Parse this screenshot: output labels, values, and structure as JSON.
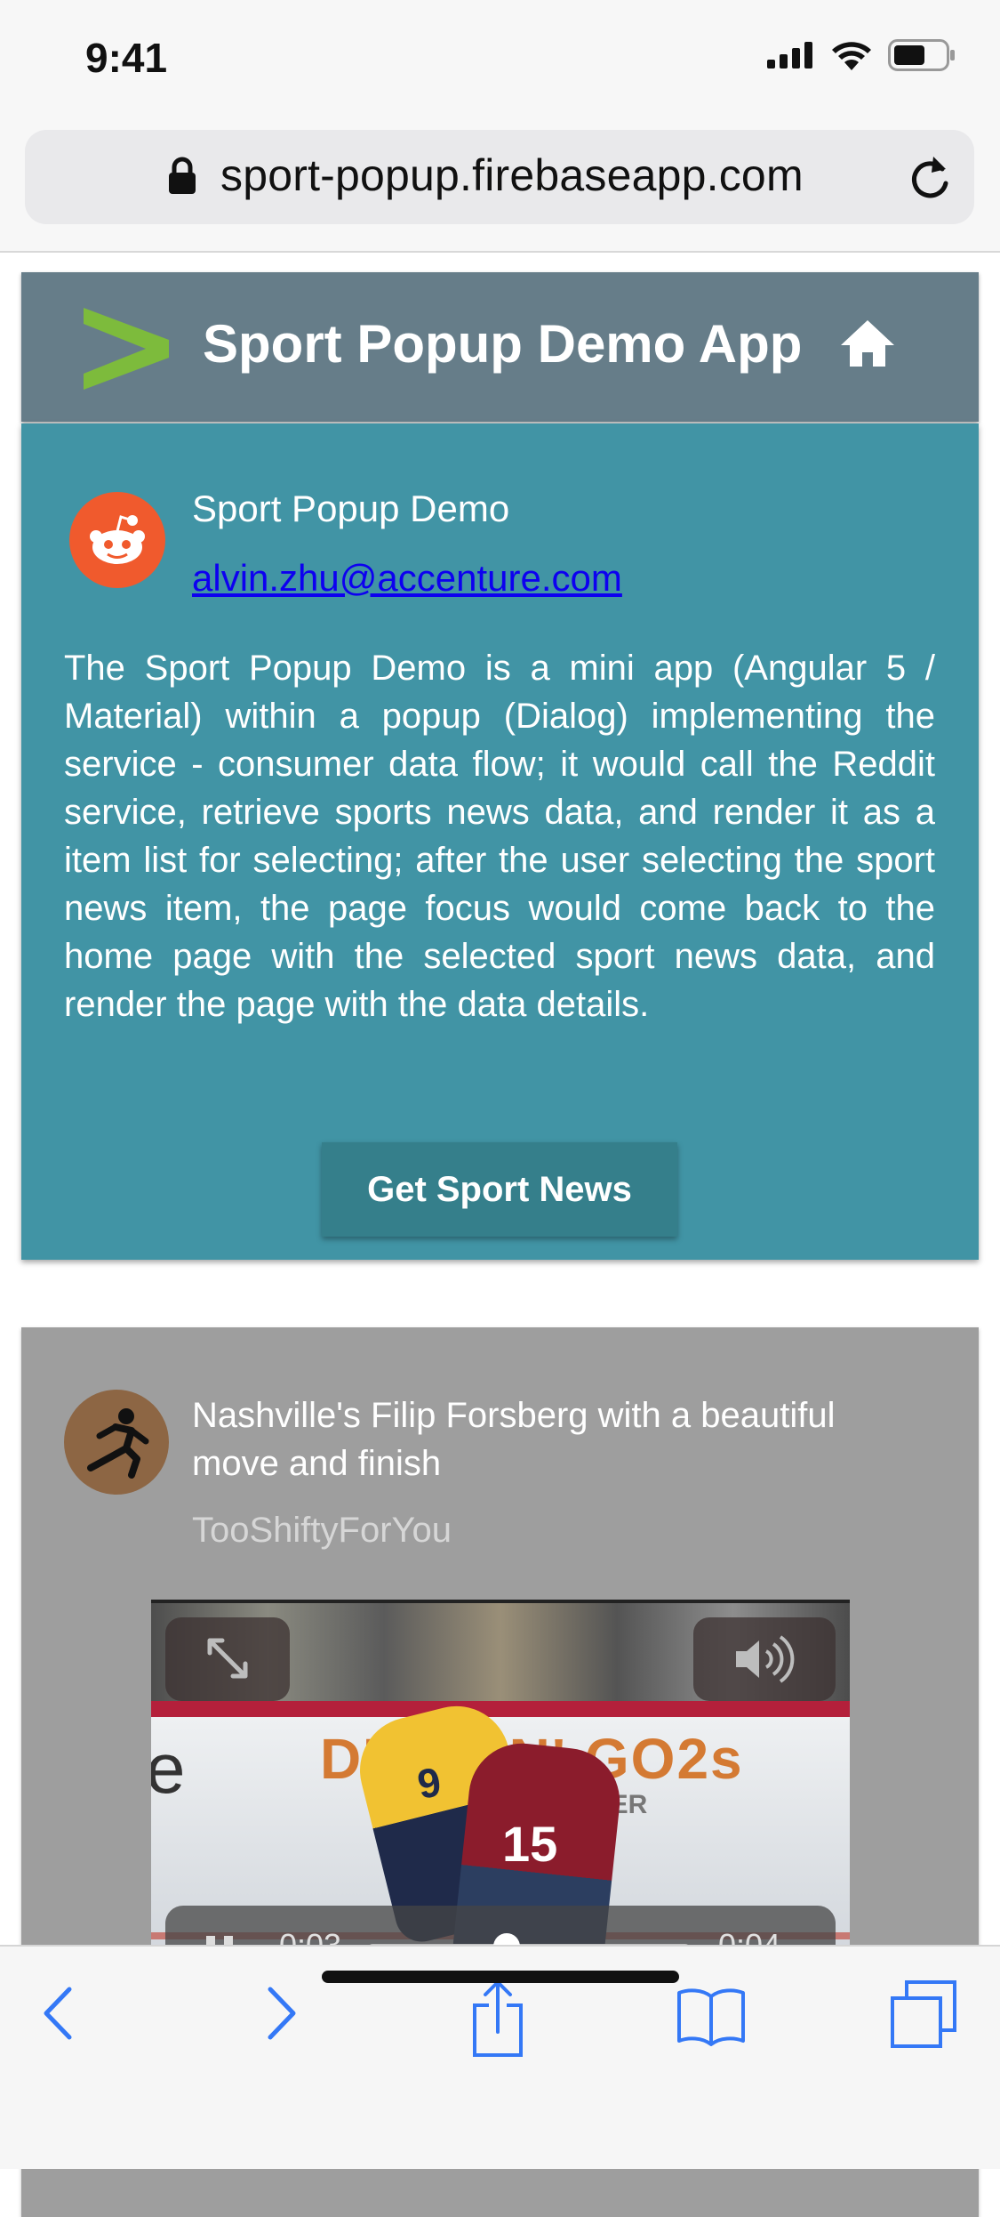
{
  "status_bar": {
    "time": "9:41"
  },
  "browser": {
    "url": "sport-popup.firebaseapp.com"
  },
  "app_header": {
    "title": "Sport Popup Demo App"
  },
  "intro_card": {
    "title": "Sport Popup Demo",
    "email": "alvin.zhu@accenture.com",
    "description": "The Sport Popup Demo is a mini app (Angular 5 / Material) within a popup (Dialog) implementing the service - consumer data flow; it would call the Reddit service, retrieve sports news data, and render it as a item list for selecting; after the user selecting the sport news item, the page focus would come back to the home page with the selected sport news data, and render the page with the data details.",
    "button_label": "Get Sport News"
  },
  "news_item": {
    "title": "Nashville's Filip Forsberg with a beautiful move and finish",
    "author": "TooShiftyForYou",
    "video": {
      "elapsed": "0:03",
      "remaining": "-0:04",
      "progress": 0.43
    }
  },
  "colors": {
    "header_bg": "#667d89",
    "intro_bg": "#4194a5",
    "button_bg": "#357f8b",
    "news_bg": "#9e9e9e",
    "ios_blue": "#3478f6",
    "reddit_orange": "#f05a2d"
  },
  "icons": {
    "toolbar": [
      "back-icon",
      "forward-icon",
      "share-icon",
      "bookmarks-icon",
      "tabs-icon"
    ]
  }
}
